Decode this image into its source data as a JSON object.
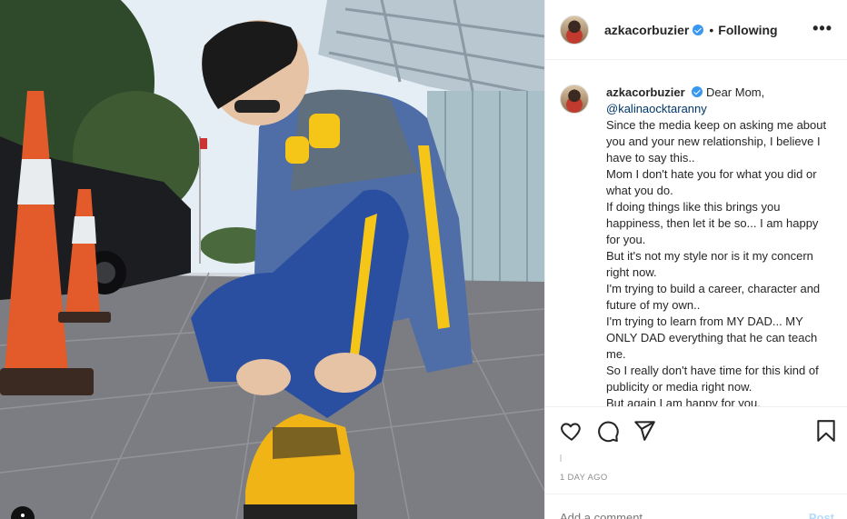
{
  "post": {
    "username": "azkacorbuzier",
    "separator": "•",
    "follow_status": "Following",
    "more_icon": "more-horizontal-icon",
    "more_glyph": "•••",
    "verified": true
  },
  "caption": {
    "username": "azkacorbuzier",
    "greeting": "Dear Mom,",
    "mention": "@kalinaocktaranny",
    "lines": [
      "Since the media keep on asking me about you and your new relationship, I believe I have to say this..",
      "Mom I don't hate you for what you did or what you do.",
      "If doing things like this brings you happiness, then let it be so... I am happy for you.",
      "But it's not my style nor is it my concern right now.",
      "I'm trying to build a career, character and future of my own..",
      "I'm trying to learn from MY DAD... MY ONLY DAD everything that he can teach me.",
      "So I really don't have time for this kind of publicity or media right now.",
      "But again I am happy for you."
    ]
  },
  "actions": {
    "icons": [
      "heart-icon",
      "comment-icon",
      "share-icon",
      "bookmark-icon"
    ]
  },
  "timestamp": "1 DAY AGO",
  "comment": {
    "placeholder": "Add a comment...",
    "post_label": "Post"
  },
  "colors": {
    "verified": "#3897f0",
    "mention": "#00376b",
    "muted": "#8e8e8e",
    "post_disabled": "#b3dbff"
  }
}
